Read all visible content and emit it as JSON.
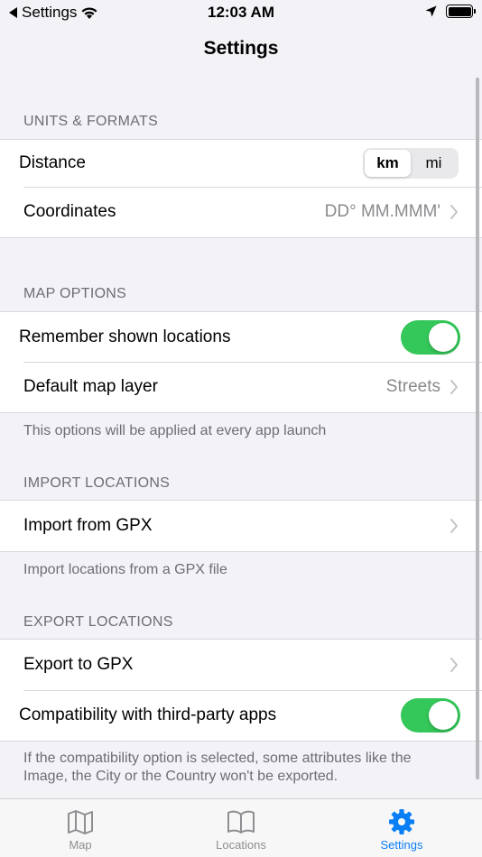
{
  "status": {
    "back_label": "Settings",
    "time": "12:03 AM"
  },
  "nav": {
    "title": "Settings"
  },
  "sections": {
    "units": {
      "header": "UNITS & FORMATS",
      "distance_label": "Distance",
      "distance_options": [
        "km",
        "mi"
      ],
      "distance_selected": "km",
      "coordinates_label": "Coordinates",
      "coordinates_value": "DD° MM.MMM'"
    },
    "map": {
      "header": "MAP OPTIONS",
      "remember_label": "Remember shown locations",
      "remember_on": true,
      "layer_label": "Default map layer",
      "layer_value": "Streets",
      "footer": "This options will be applied at every app launch"
    },
    "import": {
      "header": "IMPORT LOCATIONS",
      "gpx_label": "Import from GPX",
      "footer": "Import locations from a GPX file"
    },
    "export": {
      "header": "EXPORT LOCATIONS",
      "gpx_label": "Export to GPX",
      "compat_label": "Compatibility with third-party apps",
      "compat_on": true,
      "footer": "If the compatibility option is selected, some attributes like the Image, the City or the Country won't be exported."
    }
  },
  "tabs": [
    {
      "label": "Map",
      "icon": "map-icon"
    },
    {
      "label": "Locations",
      "icon": "book-icon"
    },
    {
      "label": "Settings",
      "icon": "gear-icon"
    }
  ],
  "colors": {
    "accent": "#0a7ff5",
    "toggle_on": "#34c759"
  }
}
